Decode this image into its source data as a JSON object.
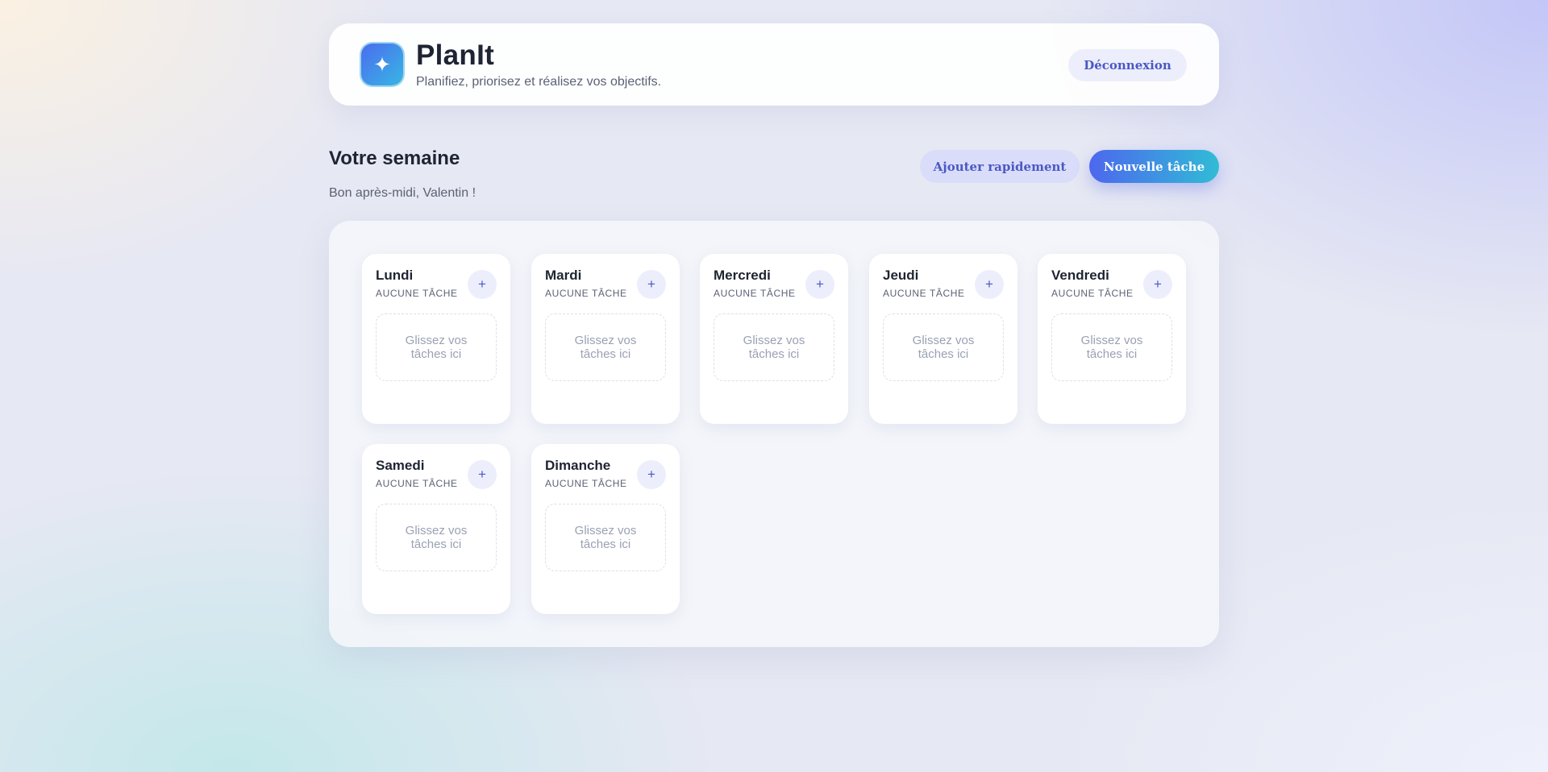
{
  "header": {
    "logo_icon": "sparkle-icon",
    "logo_glyph": "✦",
    "title": "PlanIt",
    "subtitle": "Planifiez, priorisez et réalisez vos objectifs.",
    "logout_label": "Déconnexion"
  },
  "week": {
    "title": "Votre semaine",
    "greeting": "Bon après-midi, Valentin !",
    "quick_add_label": "Ajouter rapidement",
    "new_task_label": "Nouvelle tâche"
  },
  "days": [
    {
      "name": "Lundi",
      "count": "AUCUNE TÂCHE",
      "add": "+",
      "drop": "Glissez vos tâches ici"
    },
    {
      "name": "Mardi",
      "count": "AUCUNE TÂCHE",
      "add": "+",
      "drop": "Glissez vos tâches ici"
    },
    {
      "name": "Mercredi",
      "count": "AUCUNE TÂCHE",
      "add": "+",
      "drop": "Glissez vos tâches ici"
    },
    {
      "name": "Jeudi",
      "count": "AUCUNE TÂCHE",
      "add": "+",
      "drop": "Glissez vos tâches ici"
    },
    {
      "name": "Vendredi",
      "count": "AUCUNE TÂCHE",
      "add": "+",
      "drop": "Glissez vos tâches ici"
    },
    {
      "name": "Samedi",
      "count": "AUCUNE TÂCHE",
      "add": "+",
      "drop": "Glissez vos tâches ici"
    },
    {
      "name": "Dimanche",
      "count": "AUCUNE TÂCHE",
      "add": "+",
      "drop": "Glissez vos tâches ici"
    }
  ],
  "colors": {
    "accent": "#4b58c4",
    "gradient_start": "#4d67ee",
    "gradient_end": "#30bcd6"
  }
}
